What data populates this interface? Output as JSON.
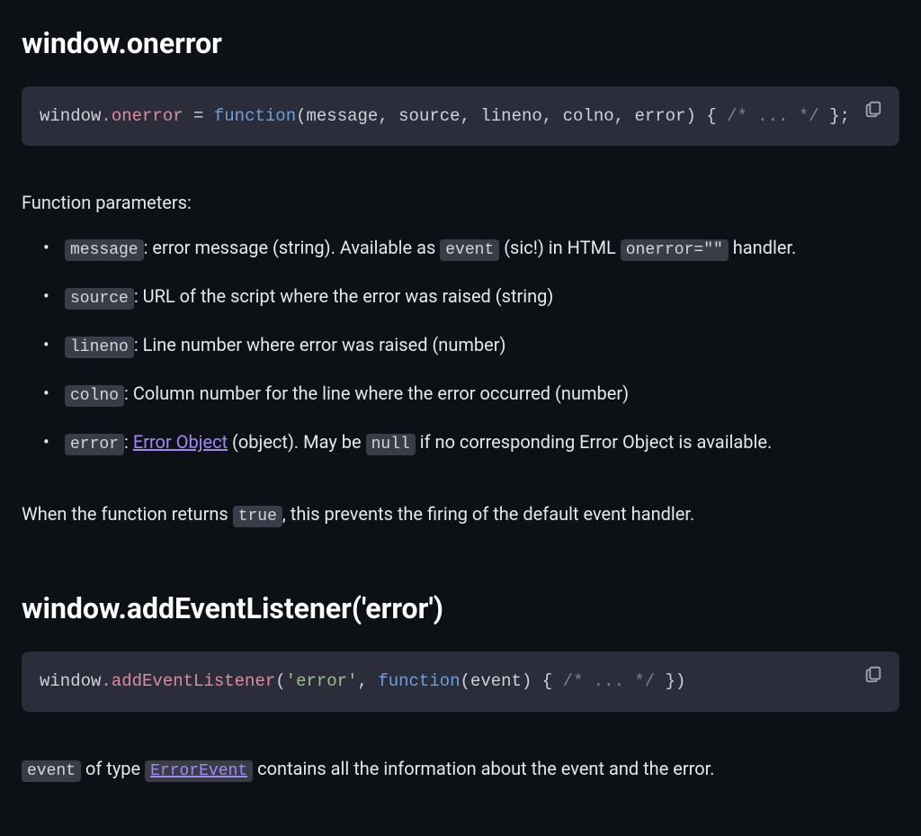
{
  "section1": {
    "heading": "window.onerror",
    "code": {
      "obj": "window",
      "dot": ".",
      "prop": "onerror",
      "eq": " = ",
      "kw": "function",
      "lparen": "(",
      "arg1": "message",
      "comma": ", ",
      "arg2": "source",
      "arg3": "lineno",
      "arg4": "colno",
      "arg5": "error",
      "rparen": ")",
      "brace_open": " { ",
      "comment": "/* ... */",
      "brace_close": " };"
    }
  },
  "params": {
    "intro": "Function parameters:",
    "items": {
      "message": {
        "name": "message",
        "text1": ": error message (string). Available as ",
        "code1": "event",
        "text2": " (sic!) in HTML ",
        "code2": "onerror=\"\"",
        "text3": " handler."
      },
      "source": {
        "name": "source",
        "text": ": URL of the script where the error was raised (string)"
      },
      "lineno": {
        "name": "lineno",
        "text": ": Line number where error was raised (number)"
      },
      "colno": {
        "name": "colno",
        "text": ": Column number for the line where the error occurred (number)"
      },
      "error": {
        "name": "error",
        "sep": ": ",
        "link": "Error Object",
        "text1": " (object). May be ",
        "code1": "null",
        "text2": " if no corresponding Error Object is available."
      }
    }
  },
  "returns": {
    "text1": "When the function returns ",
    "code1": "true",
    "text2": ", this prevents the firing of the default event handler."
  },
  "section2": {
    "heading": "window.addEventListener('error')",
    "code": {
      "obj": "window",
      "dot": ".",
      "method": "addEventListener",
      "lparen": "(",
      "str": "'error'",
      "comma": ", ",
      "kw": "function",
      "lparen2": "(",
      "arg": "event",
      "rparen2": ")",
      "brace_open": " { ",
      "comment": "/* ... */",
      "tail": " })"
    }
  },
  "trailer2": {
    "code1": "event",
    "text1": " of type ",
    "link": "ErrorEvent",
    "text2": " contains all the information about the event and the error."
  }
}
